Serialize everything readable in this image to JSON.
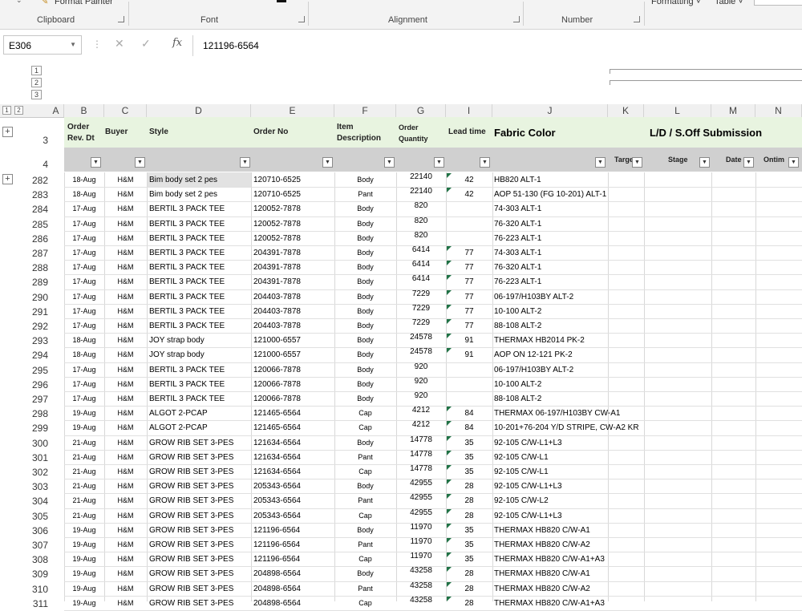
{
  "ribbon": {
    "format_painter": "Format Painter",
    "formatting": "Formatting ˅",
    "table": "Table ˅",
    "groups": [
      "Clipboard",
      "Font",
      "Alignment",
      "Number"
    ]
  },
  "formula_bar": {
    "name_box": "E306",
    "content": "121196-6564",
    "fx": "fx"
  },
  "outline_levels": [
    "1",
    "2",
    "3"
  ],
  "columns": [
    "A",
    "B",
    "C",
    "D",
    "E",
    "F",
    "G",
    "I",
    "J",
    "K",
    "L",
    "M",
    "N"
  ],
  "header_row": {
    "row_num": "3",
    "order_rev_dt": "Order Rev. Dt",
    "buyer": "Buyer",
    "style": "Style",
    "order_no": "Order No",
    "item_description": "Item Description",
    "order_quantity": "Order Quantity",
    "lead_time": "Lead time",
    "fabric_color": "Fabric Color",
    "submission": "L/D / S.Off  Submission"
  },
  "subheader_row": {
    "row_num": "4",
    "target": "Targe",
    "stage": "Stage",
    "date": "Date",
    "ontime": "Ontim"
  },
  "rows": [
    {
      "n": "282",
      "dt": "18-Aug",
      "buyer": "H&M",
      "style": "Bim body set 2 pes",
      "order": "120710-6525",
      "item": "Body",
      "qty": "22140",
      "lead": "42",
      "color": "HB820 ALT-1"
    },
    {
      "n": "283",
      "dt": "18-Aug",
      "buyer": "H&M",
      "style": "Bim body set 2 pes",
      "order": "120710-6525",
      "item": "Pant",
      "qty": "22140",
      "lead": "42",
      "color": "AOP 51-130 (FG 10-201) ALT-1"
    },
    {
      "n": "284",
      "dt": "17-Aug",
      "buyer": "H&M",
      "style": "BERTIL 3 PACK TEE",
      "order": "120052-7878",
      "item": "Body",
      "qty": "820",
      "lead": "",
      "color": "74-303 ALT-1"
    },
    {
      "n": "285",
      "dt": "17-Aug",
      "buyer": "H&M",
      "style": "BERTIL 3 PACK TEE",
      "order": "120052-7878",
      "item": "Body",
      "qty": "820",
      "lead": "",
      "color": "76-320 ALT-1"
    },
    {
      "n": "286",
      "dt": "17-Aug",
      "buyer": "H&M",
      "style": "BERTIL 3 PACK TEE",
      "order": "120052-7878",
      "item": "Body",
      "qty": "820",
      "lead": "",
      "color": "76-223 ALT-1"
    },
    {
      "n": "287",
      "dt": "17-Aug",
      "buyer": "H&M",
      "style": "BERTIL 3 PACK TEE",
      "order": "204391-7878",
      "item": "Body",
      "qty": "6414",
      "lead": "77",
      "color": "74-303 ALT-1"
    },
    {
      "n": "288",
      "dt": "17-Aug",
      "buyer": "H&M",
      "style": "BERTIL 3 PACK TEE",
      "order": "204391-7878",
      "item": "Body",
      "qty": "6414",
      "lead": "77",
      "color": "76-320 ALT-1"
    },
    {
      "n": "289",
      "dt": "17-Aug",
      "buyer": "H&M",
      "style": "BERTIL 3 PACK TEE",
      "order": "204391-7878",
      "item": "Body",
      "qty": "6414",
      "lead": "77",
      "color": "76-223 ALT-1"
    },
    {
      "n": "290",
      "dt": "17-Aug",
      "buyer": "H&M",
      "style": "BERTIL 3 PACK TEE",
      "order": "204403-7878",
      "item": "Body",
      "qty": "7229",
      "lead": "77",
      "color": "06-197/H103BY ALT-2"
    },
    {
      "n": "291",
      "dt": "17-Aug",
      "buyer": "H&M",
      "style": "BERTIL 3 PACK TEE",
      "order": "204403-7878",
      "item": "Body",
      "qty": "7229",
      "lead": "77",
      "color": "10-100 ALT-2"
    },
    {
      "n": "292",
      "dt": "17-Aug",
      "buyer": "H&M",
      "style": "BERTIL 3 PACK TEE",
      "order": "204403-7878",
      "item": "Body",
      "qty": "7229",
      "lead": "77",
      "color": "88-108 ALT-2"
    },
    {
      "n": "293",
      "dt": "18-Aug",
      "buyer": "H&M",
      "style": "JOY strap body",
      "order": "121000-6557",
      "item": "Body",
      "qty": "24578",
      "lead": "91",
      "color": "THERMAX HB2014 PK-2"
    },
    {
      "n": "294",
      "dt": "18-Aug",
      "buyer": "H&M",
      "style": "JOY strap body",
      "order": "121000-6557",
      "item": "Body",
      "qty": "24578",
      "lead": "91",
      "color": "AOP ON 12-121 PK-2"
    },
    {
      "n": "295",
      "dt": "17-Aug",
      "buyer": "H&M",
      "style": "BERTIL 3 PACK TEE",
      "order": "120066-7878",
      "item": "Body",
      "qty": "920",
      "lead": "",
      "color": "06-197/H103BY ALT-2"
    },
    {
      "n": "296",
      "dt": "17-Aug",
      "buyer": "H&M",
      "style": "BERTIL 3 PACK TEE",
      "order": "120066-7878",
      "item": "Body",
      "qty": "920",
      "lead": "",
      "color": "10-100 ALT-2"
    },
    {
      "n": "297",
      "dt": "17-Aug",
      "buyer": "H&M",
      "style": "BERTIL 3 PACK TEE",
      "order": "120066-7878",
      "item": "Body",
      "qty": "920",
      "lead": "",
      "color": "88-108 ALT-2"
    },
    {
      "n": "298",
      "dt": "19-Aug",
      "buyer": "H&M",
      "style": "ALGOT 2-PCAP",
      "order": "121465-6564",
      "item": "Cap",
      "qty": "4212",
      "lead": "84",
      "color": "THERMAX 06-197/H103BY CW-A1"
    },
    {
      "n": "299",
      "dt": "19-Aug",
      "buyer": "H&M",
      "style": "ALGOT 2-PCAP",
      "order": "121465-6564",
      "item": "Cap",
      "qty": "4212",
      "lead": "84",
      "color": "10-201+76-204 Y/D STRIPE, CW-A2 KR"
    },
    {
      "n": "300",
      "dt": "21-Aug",
      "buyer": "H&M",
      "style": "GROW RIB SET 3-PES",
      "order": "121634-6564",
      "item": "Body",
      "qty": "14778",
      "lead": "35",
      "color": "92-105 C/W-L1+L3"
    },
    {
      "n": "301",
      "dt": "21-Aug",
      "buyer": "H&M",
      "style": "GROW RIB SET 3-PES",
      "order": "121634-6564",
      "item": "Pant",
      "qty": "14778",
      "lead": "35",
      "color": "92-105 C/W-L1"
    },
    {
      "n": "302",
      "dt": "21-Aug",
      "buyer": "H&M",
      "style": "GROW RIB SET 3-PES",
      "order": "121634-6564",
      "item": "Cap",
      "qty": "14778",
      "lead": "35",
      "color": "92-105 C/W-L1"
    },
    {
      "n": "303",
      "dt": "21-Aug",
      "buyer": "H&M",
      "style": "GROW RIB  SET 3-PES",
      "order": "205343-6564",
      "item": "Body",
      "qty": "42955",
      "lead": "28",
      "color": "92-105 C/W-L1+L3"
    },
    {
      "n": "304",
      "dt": "21-Aug",
      "buyer": "H&M",
      "style": "GROW RIB  SET 3-PES",
      "order": "205343-6564",
      "item": "Pant",
      "qty": "42955",
      "lead": "28",
      "color": "92-105 C/W-L2"
    },
    {
      "n": "305",
      "dt": "21-Aug",
      "buyer": "H&M",
      "style": "GROW RIB  SET 3-PES",
      "order": "205343-6564",
      "item": "Cap",
      "qty": "42955",
      "lead": "28",
      "color": "92-105 C/W-L1+L3"
    },
    {
      "n": "306",
      "dt": "19-Aug",
      "buyer": "H&M",
      "style": "GROW RIB  SET 3-PES",
      "order": "121196-6564",
      "item": "Body",
      "qty": "11970",
      "lead": "35",
      "color": "THERMAX HB820 C/W-A1"
    },
    {
      "n": "307",
      "dt": "19-Aug",
      "buyer": "H&M",
      "style": "GROW RIB  SET 3-PES",
      "order": "121196-6564",
      "item": "Pant",
      "qty": "11970",
      "lead": "35",
      "color": "THERMAX HB820 C/W-A2"
    },
    {
      "n": "308",
      "dt": "19-Aug",
      "buyer": "H&M",
      "style": "GROW RIB  SET 3-PES",
      "order": "121196-6564",
      "item": "Cap",
      "qty": "11970",
      "lead": "35",
      "color": "THERMAX HB820 C/W-A1+A3"
    },
    {
      "n": "309",
      "dt": "19-Aug",
      "buyer": "H&M",
      "style": "GROW RIB  SET 3-PES",
      "order": "204898-6564",
      "item": "Body",
      "qty": "43258",
      "lead": "28",
      "color": "THERMAX HB820 C/W-A1"
    },
    {
      "n": "310",
      "dt": "19-Aug",
      "buyer": "H&M",
      "style": "GROW RIB  SET 3-PES",
      "order": "204898-6564",
      "item": "Pant",
      "qty": "43258",
      "lead": "28",
      "color": "THERMAX HB820 C/W-A2"
    },
    {
      "n": "311",
      "dt": "19-Aug",
      "buyer": "H&M",
      "style": "GROW RIB  SET 3-PES",
      "order": "204898-6564",
      "item": "Cap",
      "qty": "43258",
      "lead": "28",
      "color": "THERMAX HB820 C/W-A1+A3"
    }
  ],
  "colors": {
    "header_fill": "#e8f4e0",
    "subheader_fill": "#d0d0d0",
    "excel_green": "#207245"
  }
}
